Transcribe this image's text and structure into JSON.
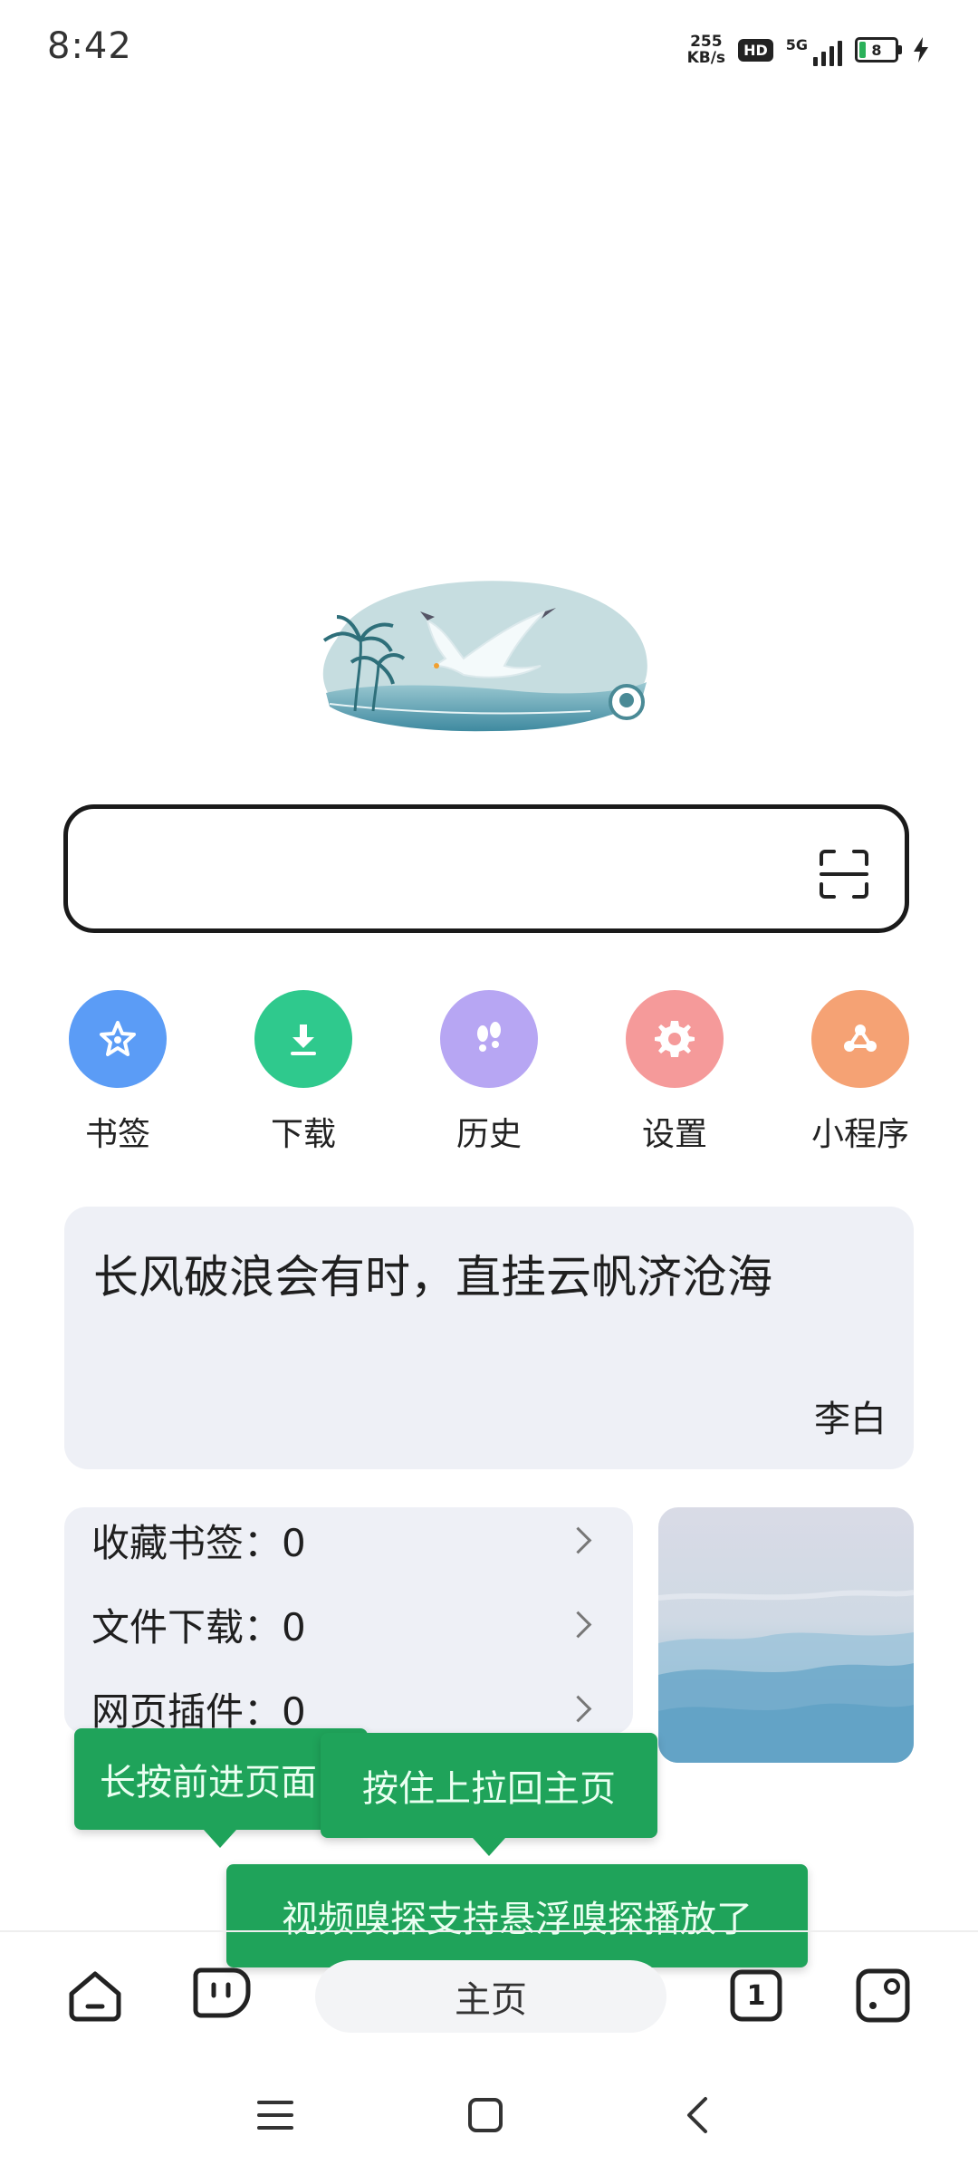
{
  "status": {
    "time": "8:42",
    "speed_value": "255",
    "speed_unit": "KB/s",
    "hd": "HD",
    "network": "5G",
    "battery": "8"
  },
  "search": {
    "placeholder": ""
  },
  "shortcuts": [
    {
      "label": "书签",
      "icon": "star-icon",
      "color": "#5b9cf6"
    },
    {
      "label": "下载",
      "icon": "download-icon",
      "color": "#2fc98d"
    },
    {
      "label": "历史",
      "icon": "footprints-icon",
      "color": "#b7a6f3"
    },
    {
      "label": "设置",
      "icon": "gear-icon",
      "color": "#f59a9a"
    },
    {
      "label": "小程序",
      "icon": "mini-program-icon",
      "color": "#f5a274"
    }
  ],
  "quote": {
    "text": "长风破浪会有时，直挂云帆济沧海",
    "author": "李白"
  },
  "stats": [
    {
      "label": "收藏书签：0"
    },
    {
      "label": "文件下载：0"
    },
    {
      "label": "网页插件：0"
    }
  ],
  "tooltips": {
    "forward": "长按前进页面",
    "home": "按住上拉回主页",
    "video": "视频嗅探支持悬浮嗅探播放了"
  },
  "bottom_bar": {
    "home_label": "主页",
    "tab_count": "1"
  }
}
